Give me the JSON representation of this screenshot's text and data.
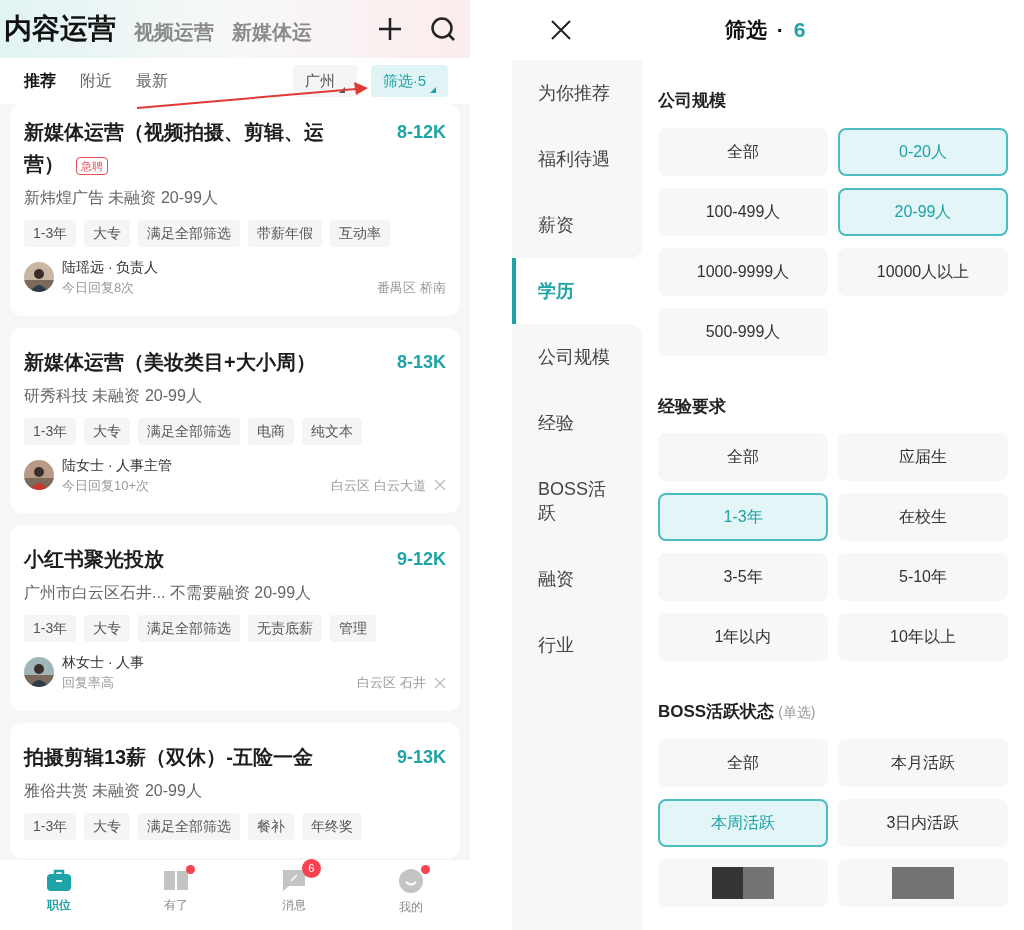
{
  "jobs_screen": {
    "top_tabs": [
      {
        "label": "内容运营",
        "selected": true
      },
      {
        "label": "视频运营",
        "selected": false
      },
      {
        "label": "新媒体运",
        "selected": false
      }
    ],
    "sub_tabs": [
      {
        "label": "推荐",
        "selected": true
      },
      {
        "label": "附近",
        "selected": false
      },
      {
        "label": "最新",
        "selected": false
      }
    ],
    "city_chip": "广州",
    "filter_chip": {
      "label": "筛选·5",
      "selected": true
    },
    "jobs": [
      {
        "title": "新媒体运营（视频拍摄、剪辑、运营）",
        "badge": "急聘",
        "salary": "8-12K",
        "company": "新炜煌广告 未融资 20-99人",
        "tags": [
          "1-3年",
          "大专",
          "满足全部筛选",
          "带薪年假",
          "互动率"
        ],
        "recruiter": "陆瑶远 · 负责人",
        "reply": "今日回复8次",
        "location": "番禺区 桥南",
        "dismissible": false
      },
      {
        "title": "新媒体运营（美妆类目+大小周）",
        "salary": "8-13K",
        "company": "研秀科技 未融资 20-99人",
        "tags": [
          "1-3年",
          "大专",
          "满足全部筛选",
          "电商",
          "纯文本"
        ],
        "recruiter": "陆女士 · 人事主管",
        "reply": "今日回复10+次",
        "location": "白云区 白云大道",
        "dismissible": true
      },
      {
        "title": "小红书聚光投放",
        "salary": "9-12K",
        "company": "广州市白云区石井... 不需要融资 20-99人",
        "tags": [
          "1-3年",
          "大专",
          "满足全部筛选",
          "无责底薪",
          "管理"
        ],
        "recruiter": "林女士 · 人事",
        "reply": "回复率高",
        "location": "白云区 石井",
        "dismissible": true
      },
      {
        "title": "拍摄剪辑13薪（双休）-五险一金",
        "salary": "9-13K",
        "company": "雅俗共赏 未融资 20-99人",
        "tags": [
          "1-3年",
          "大专",
          "满足全部筛选",
          "餐补",
          "年终奖"
        ]
      }
    ],
    "bottom_nav": [
      {
        "kind": "briefcase",
        "label": "职位",
        "selected": true,
        "dot": false
      },
      {
        "kind": "book",
        "label": "有了",
        "selected": false,
        "dot": true
      },
      {
        "kind": "chat",
        "label": "消息",
        "selected": false,
        "dot": false,
        "badge": "6"
      },
      {
        "kind": "face",
        "label": "我的",
        "selected": false,
        "dot": true
      }
    ]
  },
  "filter_screen": {
    "title": "筛选",
    "separator": "·",
    "count": "6",
    "sidebar": [
      {
        "label": "为你推荐",
        "selected": false
      },
      {
        "label": "福利待遇",
        "selected": false
      },
      {
        "label": "薪资",
        "selected": false
      },
      {
        "label": "学历",
        "selected": true
      },
      {
        "label": "公司规模",
        "selected": false
      },
      {
        "label": "经验",
        "selected": false
      },
      {
        "label": "BOSS活跃",
        "selected": false
      },
      {
        "label": "融资",
        "selected": false
      },
      {
        "label": "行业",
        "selected": false
      }
    ],
    "sections": [
      {
        "title": "公司规模",
        "options": [
          {
            "label": "全部",
            "selected": false
          },
          {
            "label": "0-20人",
            "selected": true
          },
          {
            "label": "100-499人",
            "selected": false
          },
          {
            "label": "20-99人",
            "selected": true
          },
          {
            "label": "1000-9999人",
            "selected": false
          },
          {
            "label": "10000人以上",
            "selected": false
          },
          {
            "label": "500-999人",
            "selected": false
          }
        ]
      },
      {
        "title": "经验要求",
        "options": [
          {
            "label": "全部",
            "selected": false
          },
          {
            "label": "应届生",
            "selected": false
          },
          {
            "label": "1-3年",
            "selected": true
          },
          {
            "label": "在校生",
            "selected": false
          },
          {
            "label": "3-5年",
            "selected": false
          },
          {
            "label": "5-10年",
            "selected": false
          },
          {
            "label": "1年以内",
            "selected": false
          },
          {
            "label": "10年以上",
            "selected": false
          }
        ]
      },
      {
        "title": "BOSS活跃状态",
        "note": "(单选)",
        "options": [
          {
            "label": "全部",
            "selected": false
          },
          {
            "label": "本月活跃",
            "selected": false
          },
          {
            "label": "本周活跃",
            "selected": true
          },
          {
            "label": "3日内活跃",
            "selected": false
          }
        ],
        "hidden_row": true
      }
    ]
  }
}
